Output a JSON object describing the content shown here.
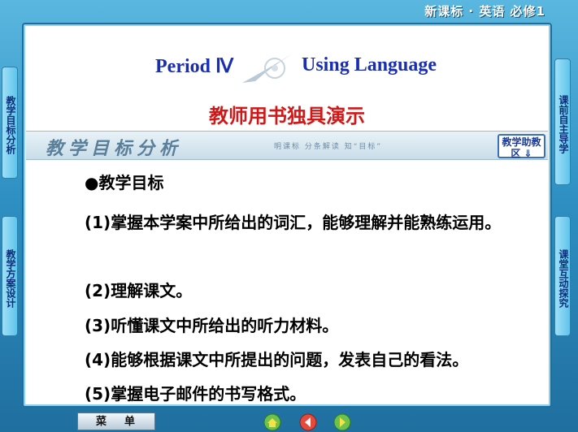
{
  "header": {
    "title": "新课标 · 英语  必修1"
  },
  "title": {
    "period": "Period Ⅳ",
    "topic": "Using Language",
    "subtitle": "教师用书独具演示"
  },
  "banner": {
    "title": "教学目标分析",
    "tip": "明课标  分条解读  知“目标”",
    "help_button": "教学助教区 ⇓"
  },
  "content": {
    "heading": "●教学目标",
    "items": [
      "(1)掌握本学案中所给出的词汇，能够理解并能熟练运用。",
      "(2)理解课文。",
      "(3)听懂课文中所给出的听力材料。",
      "(4)能够根据课文中所提出的问题，发表自己的看法。",
      "(5)掌握电子邮件的书写格式。"
    ]
  },
  "left_tabs": [
    "教学目标分析",
    "教学方案设计"
  ],
  "right_tabs": [
    "课前自主导学",
    "课堂互动探究"
  ],
  "footer": {
    "menu_label": "菜单"
  },
  "icons": [
    "home-icon",
    "back-icon",
    "forward-icon"
  ]
}
